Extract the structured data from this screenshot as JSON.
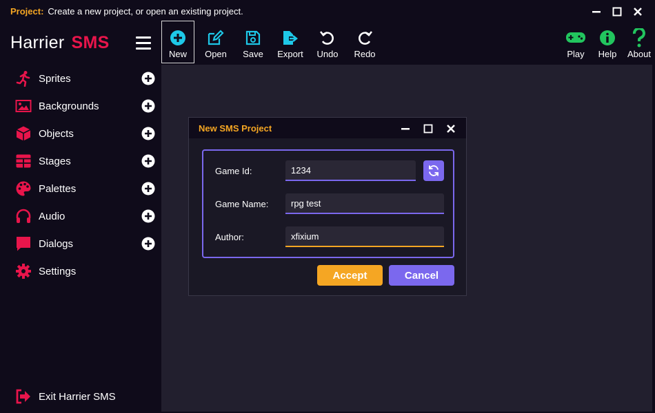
{
  "titlebar": {
    "label": "Project:",
    "message": "Create a new project, or open an existing project."
  },
  "brand": {
    "part1": "Harrier",
    "part2": "SMS"
  },
  "toolbar": {
    "items": [
      {
        "label": "New",
        "icon": "plus-circle-icon"
      },
      {
        "label": "Open",
        "icon": "edit-icon"
      },
      {
        "label": "Save",
        "icon": "save-icon"
      },
      {
        "label": "Export",
        "icon": "export-icon"
      },
      {
        "label": "Undo",
        "icon": "undo-icon"
      },
      {
        "label": "Redo",
        "icon": "redo-icon"
      }
    ],
    "right_items": [
      {
        "label": "Play",
        "icon": "gamepad-icon"
      },
      {
        "label": "Help",
        "icon": "info-icon"
      },
      {
        "label": "About",
        "icon": "question-icon"
      }
    ]
  },
  "sidebar": {
    "items": [
      {
        "label": "Sprites",
        "icon": "running-icon"
      },
      {
        "label": "Backgrounds",
        "icon": "image-icon"
      },
      {
        "label": "Objects",
        "icon": "cube-icon"
      },
      {
        "label": "Stages",
        "icon": "grid-icon"
      },
      {
        "label": "Palettes",
        "icon": "palette-icon"
      },
      {
        "label": "Audio",
        "icon": "headphones-icon"
      },
      {
        "label": "Dialogs",
        "icon": "comment-icon"
      },
      {
        "label": "Settings",
        "icon": "gear-icon"
      }
    ],
    "exit_label": "Exit Harrier SMS"
  },
  "dialog": {
    "title": "New SMS Project",
    "fields": {
      "game_id": {
        "label": "Game Id:",
        "value": "1234"
      },
      "game_name": {
        "label": "Game Name:",
        "value": "rpg test"
      },
      "author": {
        "label": "Author:",
        "value": "xfixium"
      }
    },
    "accept_label": "Accept",
    "cancel_label": "Cancel"
  },
  "colors": {
    "accent": "#e8154b",
    "orange": "#f5a623",
    "purple": "#7b68ee",
    "cyan": "#1ec8e8",
    "green": "#22c55e"
  }
}
